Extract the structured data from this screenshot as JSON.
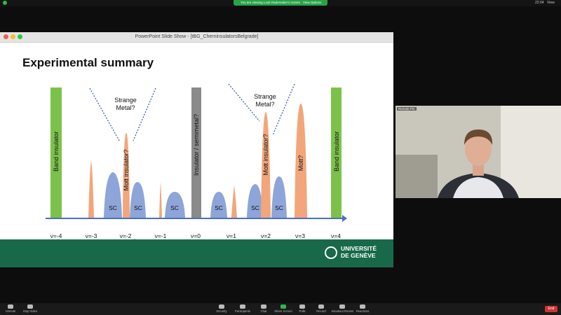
{
  "meeting": {
    "share_banner": "You are viewing Louk Rademaker's screen",
    "view_options": "View Options",
    "clock": "22:04",
    "view_button": "View",
    "participant_name": "Remote Pin"
  },
  "ppt": {
    "window_title": "PowerPoint Slide Show - [tBG_CherninsulatorsBelgrade]",
    "slide_title": "Experimental summary",
    "university": [
      "UNIVERSITÉ",
      "DE GENÈVE"
    ],
    "filling_labels": [
      "ν=-4",
      "ν=-3",
      "ν=-2",
      "ν=-1",
      "ν=0",
      "ν=1",
      "ν=2",
      "ν=3",
      "ν=4"
    ],
    "bar_labels": {
      "band_left": "Band insulator",
      "band_right": "Band insulator",
      "center": "Insulator / semimetal?",
      "mott_left": "Mott insulator?",
      "mott_right": "Mott insulator?",
      "mott_3": "Mott?"
    },
    "annotations": {
      "strange_left": [
        "Strange",
        "Metal?"
      ],
      "strange_right": [
        "Strange",
        "Metal?"
      ]
    },
    "sc_labels": [
      "SC",
      "SC",
      "SC",
      "SC",
      "SC",
      "SC"
    ]
  },
  "toolbar": {
    "items": [
      {
        "label": "Unmute"
      },
      {
        "label": "Stop Video"
      },
      {
        "label": "Security"
      },
      {
        "label": "Participants"
      },
      {
        "label": "Chat"
      },
      {
        "label": "Share Screen"
      },
      {
        "label": "Polls"
      },
      {
        "label": "Record"
      },
      {
        "label": "Breakout Rooms"
      },
      {
        "label": "Reactions"
      }
    ],
    "end_label": "End"
  },
  "colors": {
    "band_green": "#7cc24a",
    "sc_blue": "#8da5d8",
    "orange": "#f2a67a",
    "gray_bar": "#8a8a8a",
    "footer_green": "#17694a",
    "axis_blue": "#4a6fc4"
  }
}
